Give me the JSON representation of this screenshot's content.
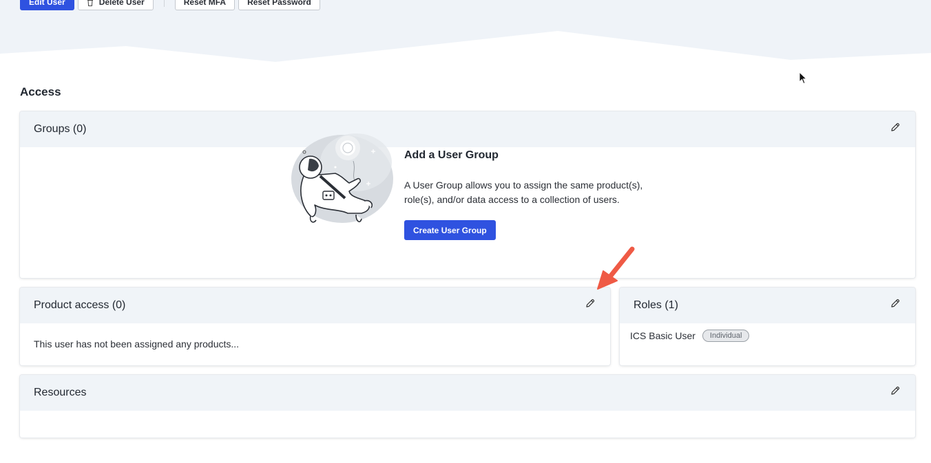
{
  "toolbar": {
    "edit_label": "Edit User",
    "delete_label": "Delete User",
    "reset_mfa_label": "Reset MFA",
    "reset_password_label": "Reset Password"
  },
  "access": {
    "title": "Access",
    "groups": {
      "title": "Groups (0)",
      "empty_title": "Add a User Group",
      "empty_desc_line1": "A User Group allows you to assign the same product(s),",
      "empty_desc_line2": "role(s), and/or data access to a collection of users.",
      "create_label": "Create User Group"
    },
    "product_access": {
      "title": "Product access (0)",
      "empty_text": "This user has not been assigned any products..."
    },
    "roles": {
      "title": "Roles (1)",
      "items": [
        {
          "name": "ICS Basic User",
          "badge": "Individual"
        }
      ]
    },
    "resources": {
      "title": "Resources"
    }
  },
  "colors": {
    "primary": "#2f52e0",
    "header_bg": "#f0f4f8",
    "hero_bg": "#eff3f8",
    "annotation_arrow": "#ef5a45"
  },
  "icons": {
    "edit": "pencil-icon",
    "delete": "trash-icon",
    "annotation": "arrow-annotation-icon",
    "cursor": "mouse-pointer-icon"
  }
}
